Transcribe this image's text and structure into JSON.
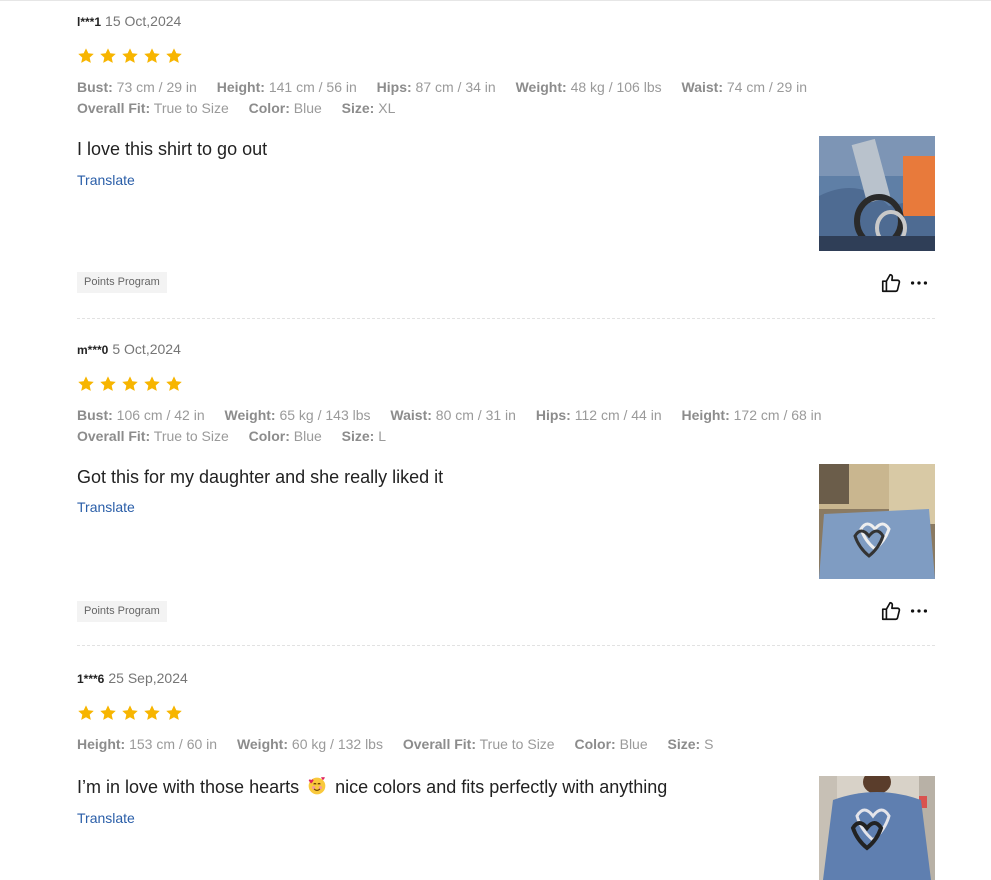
{
  "reviews": [
    {
      "user": "l***1",
      "date": "15 Oct,2024",
      "rating": 5,
      "attr_rows": [
        [
          {
            "k": "Bust:",
            "v": "73 cm / 29 in"
          },
          {
            "k": "Height:",
            "v": "141 cm / 56 in"
          },
          {
            "k": "Hips:",
            "v": "87 cm / 34 in"
          },
          {
            "k": "Weight:",
            "v": "48 kg / 106 lbs"
          },
          {
            "k": "Waist:",
            "v": "74 cm / 29 in"
          }
        ],
        [
          {
            "k": "Overall Fit:",
            "v": "True to Size"
          },
          {
            "k": "Color:",
            "v": "Blue"
          },
          {
            "k": "Size:",
            "v": "XL"
          }
        ]
      ],
      "text": "I love this shirt to go out",
      "translate": "Translate",
      "badge": "Points Program"
    },
    {
      "user": "m***0",
      "date": "5 Oct,2024",
      "rating": 5,
      "attr_rows": [
        [
          {
            "k": "Bust:",
            "v": "106 cm / 42 in"
          },
          {
            "k": "Weight:",
            "v": "65 kg / 143 lbs"
          },
          {
            "k": "Waist:",
            "v": "80 cm / 31 in"
          },
          {
            "k": "Hips:",
            "v": "112 cm / 44 in"
          },
          {
            "k": "Height:",
            "v": "172 cm / 68 in"
          }
        ],
        [
          {
            "k": "Overall Fit:",
            "v": "True to Size"
          },
          {
            "k": "Color:",
            "v": "Blue"
          },
          {
            "k": "Size:",
            "v": "L"
          }
        ]
      ],
      "text": "Got this for my daughter and she really liked it",
      "translate": "Translate",
      "badge": "Points Program"
    },
    {
      "user": "1***6",
      "date": "25 Sep,2024",
      "rating": 5,
      "attr_rows": [
        [
          {
            "k": "Height:",
            "v": "153 cm / 60 in"
          },
          {
            "k": "Weight:",
            "v": "60 kg / 132 lbs"
          },
          {
            "k": "Overall Fit:",
            "v": "True to Size"
          },
          {
            "k": "Color:",
            "v": "Blue"
          },
          {
            "k": "Size:",
            "v": "S"
          }
        ]
      ],
      "text_before": "I’m in love with those hearts",
      "text_after": "nice colors and fits perfectly with anything",
      "translate": "Translate"
    }
  ],
  "colors": {
    "star": "#f7b500",
    "link": "#2a5ea8",
    "muted": "#9a9a9a"
  },
  "icons": {
    "like": "thumbs-up-icon",
    "more": "more-dots-icon",
    "star": "star-icon",
    "emoji": "smiling-face-with-hearts-emoji"
  }
}
